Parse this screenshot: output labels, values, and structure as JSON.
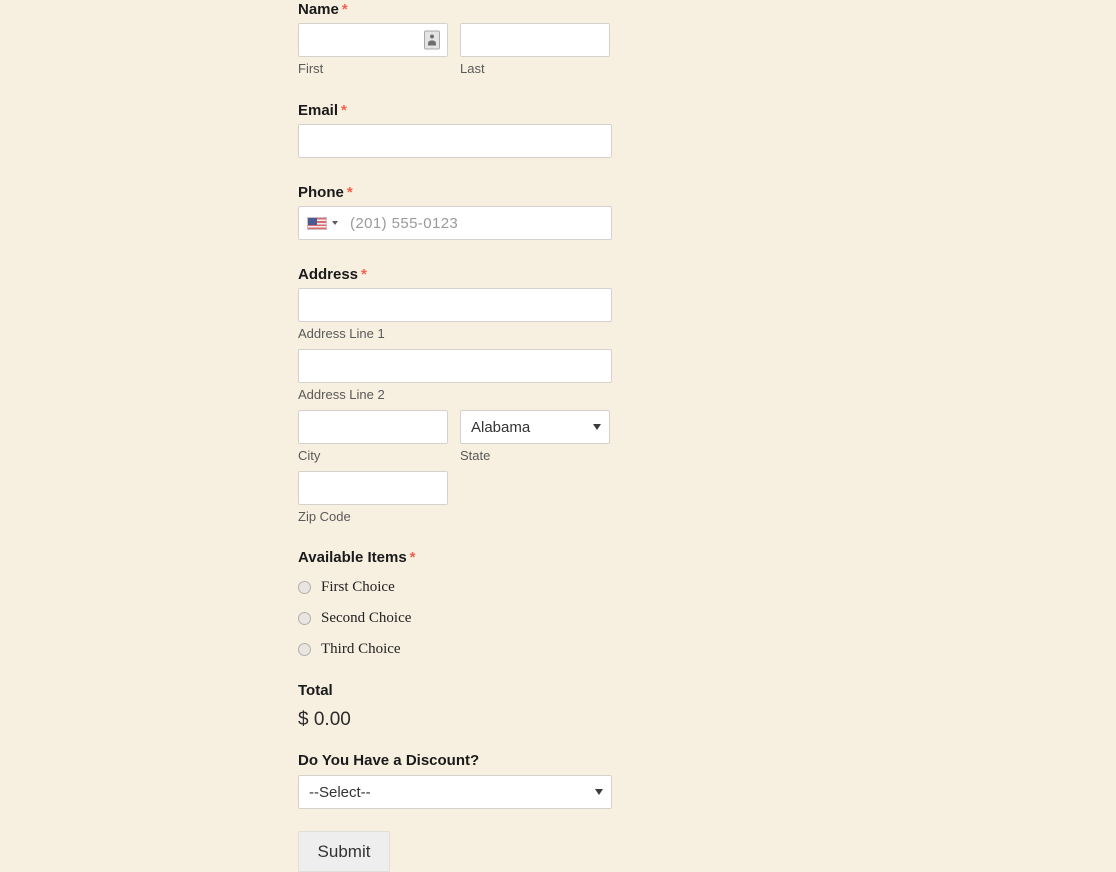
{
  "form": {
    "required_marker": "*",
    "fields": {
      "name": {
        "label": "Name",
        "required": true,
        "first": {
          "value": "",
          "sub_label": "First",
          "icon": "contact-card-icon"
        },
        "last": {
          "value": "",
          "sub_label": "Last"
        }
      },
      "email": {
        "label": "Email",
        "required": true,
        "value": ""
      },
      "phone": {
        "label": "Phone",
        "required": true,
        "country_flag": "us-flag-icon",
        "placeholder": "(201) 555-0123",
        "value": ""
      },
      "address": {
        "label": "Address",
        "required": true,
        "line1": {
          "value": "",
          "sub_label": "Address Line 1"
        },
        "line2": {
          "value": "",
          "sub_label": "Address Line 2"
        },
        "city": {
          "value": "",
          "sub_label": "City"
        },
        "state": {
          "value": "Alabama",
          "sub_label": "State"
        },
        "zip": {
          "value": "",
          "sub_label": "Zip Code"
        }
      },
      "available_items": {
        "label": "Available Items",
        "required": true,
        "options": [
          {
            "label": "First Choice",
            "selected": false
          },
          {
            "label": "Second Choice",
            "selected": false
          },
          {
            "label": "Third Choice",
            "selected": false
          }
        ]
      },
      "total": {
        "label": "Total",
        "required": false,
        "value": "$ 0.00"
      },
      "discount": {
        "label": "Do You Have a Discount?",
        "required": false,
        "value": "--Select--"
      }
    },
    "submit": {
      "label": "Submit"
    }
  },
  "theme": {
    "page_background": "#f7f0e1",
    "field_background": "#ffffff",
    "field_border": "#d5d2cd",
    "label_color": "#1a1a1a",
    "sub_label_color": "#595959",
    "required_color": "#f4604a",
    "button_background": "#eeeeee"
  }
}
